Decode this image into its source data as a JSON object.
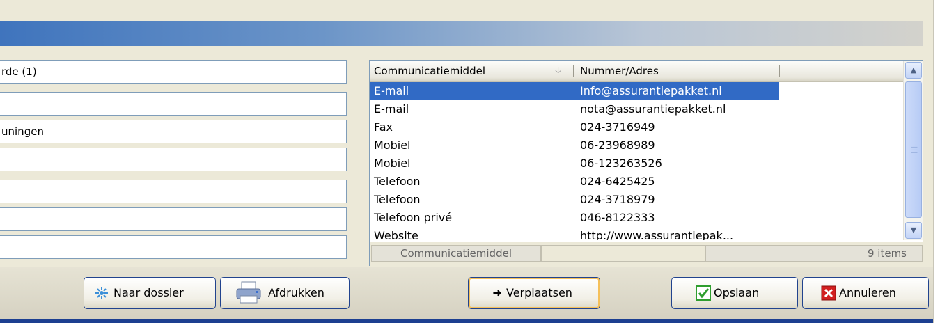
{
  "left_fields": [
    "rde (1)",
    "",
    "uningen",
    "",
    "",
    "",
    ""
  ],
  "grid": {
    "columns": [
      {
        "label": "Communicatiemiddel",
        "sort": "descending"
      },
      {
        "label": "Nummer/Adres"
      }
    ],
    "rows": [
      {
        "type": "E-mail",
        "value": "Info@assurantiepakket.nl",
        "selected": true
      },
      {
        "type": "E-mail",
        "value": "nota@assurantiepakket.nl"
      },
      {
        "type": "Fax",
        "value": "024-3716949"
      },
      {
        "type": "Mobiel",
        "value": "06-23968989"
      },
      {
        "type": "Mobiel",
        "value": "06-123263526"
      },
      {
        "type": "Telefoon",
        "value": "024-6425425"
      },
      {
        "type": "Telefoon",
        "value": "024-3718979"
      },
      {
        "type": "Telefoon privé",
        "value": "046-8122333"
      },
      {
        "type": "Website",
        "value": "http://www.assurantiepak..."
      }
    ],
    "footer": {
      "group_label": "Communicatiemiddel",
      "count": "9 items"
    }
  },
  "buttons": {
    "naar_dossier": "Naar dossier",
    "afdrukken": "Afdrukken",
    "verplaatsen": "Verplaatsen",
    "opslaan": "Opslaan",
    "annuleren": "Annuleren"
  },
  "icons": {
    "dossier": "dossier-icon",
    "printer": "printer-icon",
    "arrow": "arrow-right-icon",
    "check": "green-check-icon",
    "cancel": "red-x-icon"
  },
  "colors": {
    "banner": "#3f74bd",
    "selection": "#316ac5",
    "check": "#2f9e2f",
    "cancel": "#d21f1f"
  }
}
